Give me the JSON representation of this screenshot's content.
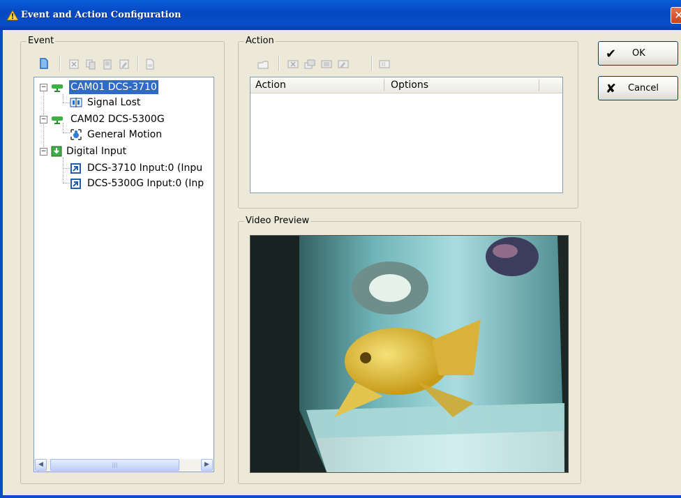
{
  "window": {
    "title": "Event and Action Configuration",
    "close_glyph": "✕"
  },
  "event_group": {
    "label": "Event",
    "toolbar": [
      "new-icon",
      "delete-icon",
      "copy-icon",
      "paste-icon",
      "edit-icon",
      "properties-icon"
    ],
    "tree": [
      {
        "label": "CAM01 DCS-3710",
        "icon": "camera-icon",
        "level": 0,
        "expanded": true,
        "selected": true
      },
      {
        "label": "Signal Lost",
        "icon": "signal-lost-icon",
        "level": 1
      },
      {
        "label": "CAM02 DCS-5300G",
        "icon": "camera-icon",
        "level": 0,
        "expanded": true
      },
      {
        "label": "General Motion",
        "icon": "motion-icon",
        "level": 1
      },
      {
        "label": "Digital Input",
        "icon": "digital-input-icon",
        "level": 0,
        "expanded": true
      },
      {
        "label": "DCS-3710 Input:0 (Inpu",
        "icon": "input-icon",
        "level": 1
      },
      {
        "label": "DCS-5300G Input:0 (Inp",
        "icon": "input-icon",
        "level": 1
      }
    ],
    "scrollbar_thumb_grip": "|||"
  },
  "action_group": {
    "label": "Action",
    "toolbar": [
      "new-action-icon",
      "delete-action-icon",
      "copy-action-icon",
      "paste-action-icon",
      "edit-action-icon",
      "properties-action-icon"
    ],
    "columns": [
      "Action",
      "Options"
    ]
  },
  "video_group": {
    "label": "Video Preview"
  },
  "buttons": {
    "ok": {
      "label": "OK",
      "icon_glyph": "✔"
    },
    "cancel": {
      "label": "Cancel",
      "icon_glyph": "✘"
    }
  },
  "colors": {
    "titlebar": "#0a4dc8",
    "selection": "#316ac5",
    "dialog_bg": "#ece9d8"
  }
}
